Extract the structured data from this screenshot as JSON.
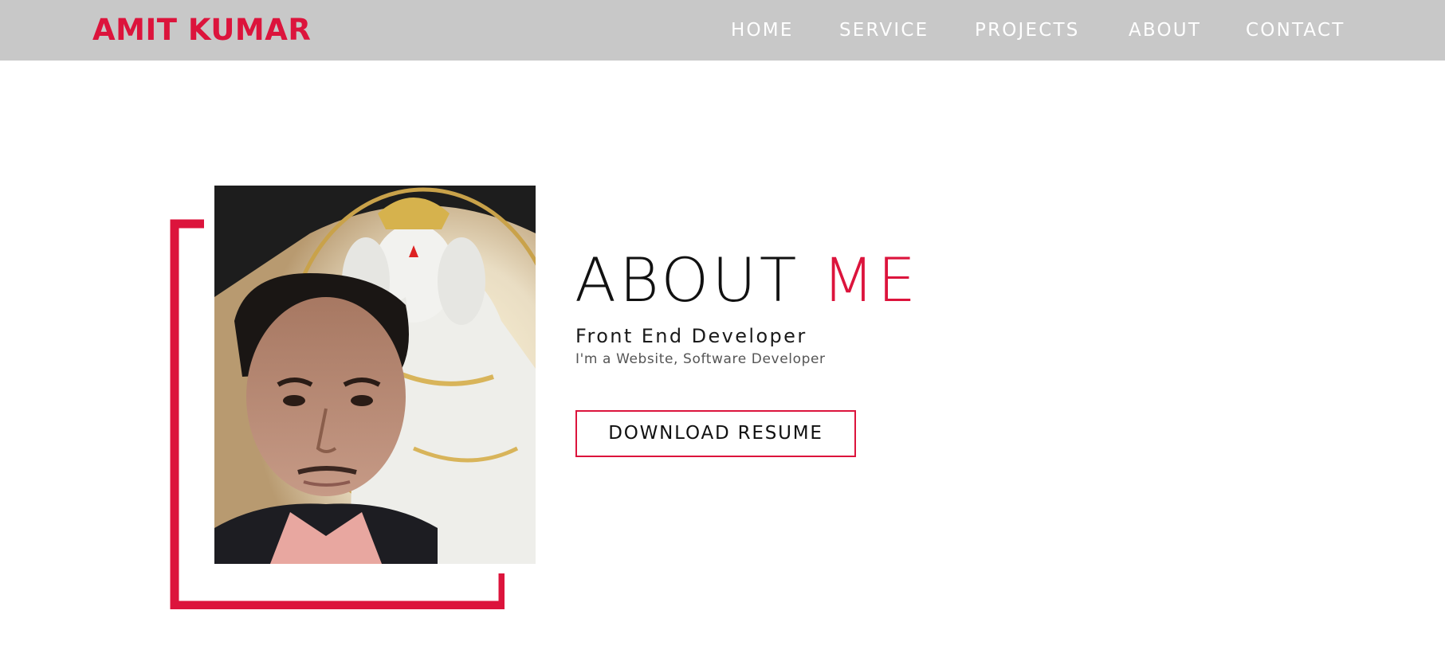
{
  "header": {
    "brand": "AMIT KUMAR",
    "nav": [
      {
        "label": "HOME"
      },
      {
        "label": "SERVICE"
      },
      {
        "label": "PROJECTS"
      },
      {
        "label": "ABOUT"
      },
      {
        "label": "CONTACT"
      }
    ]
  },
  "about": {
    "title_main": "ABOUT ",
    "title_accent": "ME",
    "role": "Front End Developer",
    "tagline": "I'm a Website, Software Developer",
    "button_label": "DOWNLOAD RESUME"
  },
  "colors": {
    "accent": "#dc143c",
    "navbar_bg": "#c8c8c8",
    "nav_text": "#ffffff"
  },
  "icons": {
    "photo": "profile-photo"
  }
}
